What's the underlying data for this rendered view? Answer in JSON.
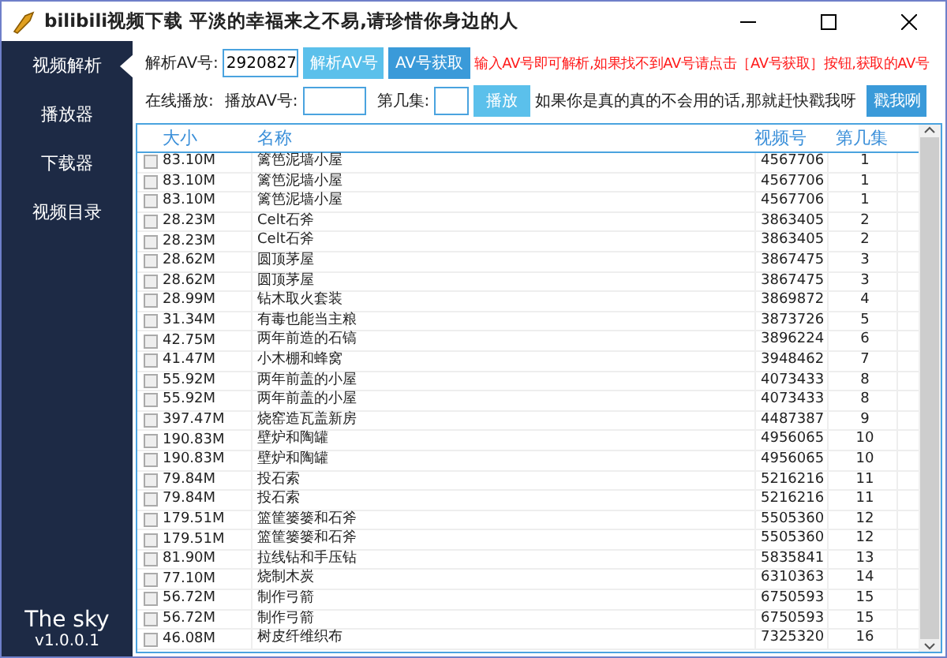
{
  "window": {
    "title": "bilibili视频下载 平淡的幸福来之不易,请珍惜你身边的人"
  },
  "sidebar": {
    "items": [
      {
        "label": "视频解析",
        "selected": true
      },
      {
        "label": "播放器",
        "selected": false
      },
      {
        "label": "下载器",
        "selected": false
      },
      {
        "label": "视频目录",
        "selected": false
      }
    ],
    "footer_title": "The sky",
    "version": "v1.0.0.1"
  },
  "parse_row": {
    "label": "解析AV号:",
    "av_value": "2920827",
    "parse_button": "解析AV号",
    "fetch_button": "AV号获取",
    "hint": "输入AV号即可解析,如果找不到AV号请点击［AV号获取］按钮,获取的AV号"
  },
  "play_row": {
    "label": "在线播放:",
    "av_label": "播放AV号:",
    "episode_label": "第几集:",
    "play_button": "播放",
    "help_text": "如果你是真的真的不会用的话,那就赶快戳我呀",
    "help_button": "戳我咧"
  },
  "table": {
    "columns": [
      "大小",
      "名称",
      "视频号",
      "第几集"
    ],
    "rows": [
      {
        "checked": false,
        "size": "83.10M",
        "name": "篱笆泥墙小屋",
        "video_id": "4567706",
        "episode": "1"
      },
      {
        "checked": false,
        "size": "83.10M",
        "name": "篱笆泥墙小屋",
        "video_id": "4567706",
        "episode": "1"
      },
      {
        "checked": false,
        "size": "83.10M",
        "name": "篱笆泥墙小屋",
        "video_id": "4567706",
        "episode": "1"
      },
      {
        "checked": false,
        "size": "28.23M",
        "name": "Celt石斧",
        "video_id": "3863405",
        "episode": "2"
      },
      {
        "checked": false,
        "size": "28.23M",
        "name": "Celt石斧",
        "video_id": "3863405",
        "episode": "2"
      },
      {
        "checked": false,
        "size": "28.62M",
        "name": "圆顶茅屋",
        "video_id": "3867475",
        "episode": "3"
      },
      {
        "checked": false,
        "size": "28.62M",
        "name": "圆顶茅屋",
        "video_id": "3867475",
        "episode": "3"
      },
      {
        "checked": false,
        "size": "28.99M",
        "name": "钻木取火套装",
        "video_id": "3869872",
        "episode": "4"
      },
      {
        "checked": false,
        "size": "31.34M",
        "name": "有毒也能当主粮",
        "video_id": "3873726",
        "episode": "5"
      },
      {
        "checked": false,
        "size": "42.75M",
        "name": "两年前造的石镐",
        "video_id": "3896224",
        "episode": "6"
      },
      {
        "checked": false,
        "size": "41.47M",
        "name": "小木棚和蜂窝",
        "video_id": "3948462",
        "episode": "7"
      },
      {
        "checked": false,
        "size": "55.92M",
        "name": "两年前盖的小屋",
        "video_id": "4073433",
        "episode": "8"
      },
      {
        "checked": false,
        "size": "55.92M",
        "name": "两年前盖的小屋",
        "video_id": "4073433",
        "episode": "8"
      },
      {
        "checked": false,
        "size": "397.47M",
        "name": "烧窑造瓦盖新房",
        "video_id": "4487387",
        "episode": "9"
      },
      {
        "checked": false,
        "size": "190.83M",
        "name": "壁炉和陶罐",
        "video_id": "4956065",
        "episode": "10"
      },
      {
        "checked": false,
        "size": "190.83M",
        "name": "壁炉和陶罐",
        "video_id": "4956065",
        "episode": "10"
      },
      {
        "checked": false,
        "size": "79.84M",
        "name": "投石索",
        "video_id": "5216216",
        "episode": "11"
      },
      {
        "checked": false,
        "size": "79.84M",
        "name": "投石索",
        "video_id": "5216216",
        "episode": "11"
      },
      {
        "checked": false,
        "size": "179.51M",
        "name": "篮筐篓篓和石斧",
        "video_id": "5505360",
        "episode": "12"
      },
      {
        "checked": false,
        "size": "179.51M",
        "name": "篮筐篓篓和石斧",
        "video_id": "5505360",
        "episode": "12"
      },
      {
        "checked": false,
        "size": "81.90M",
        "name": "拉线钻和手压钻",
        "video_id": "5835841",
        "episode": "13"
      },
      {
        "checked": false,
        "size": "77.10M",
        "name": "烧制木炭",
        "video_id": "6310363",
        "episode": "14"
      },
      {
        "checked": false,
        "size": "56.72M",
        "name": "制作弓箭",
        "video_id": "6750593",
        "episode": "15"
      },
      {
        "checked": false,
        "size": "56.72M",
        "name": "制作弓箭",
        "video_id": "6750593",
        "episode": "15"
      },
      {
        "checked": false,
        "size": "46.08M",
        "name": "树皮纤维织布",
        "video_id": "7325320",
        "episode": "16"
      }
    ]
  }
}
